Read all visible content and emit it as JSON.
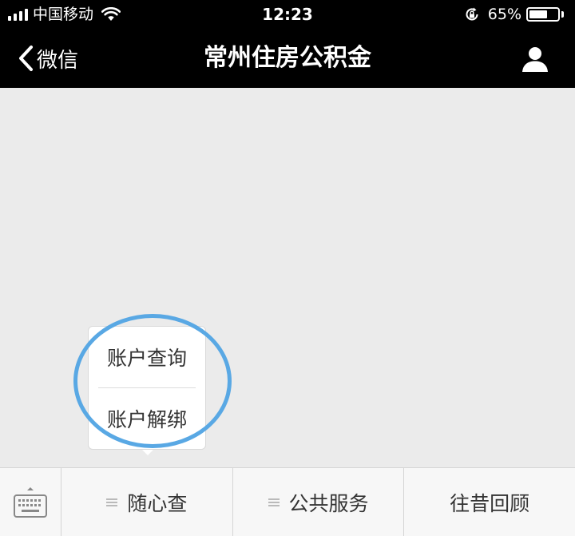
{
  "status_bar": {
    "carrier": "中国移动",
    "time": "12:23",
    "battery_percent": "65%",
    "battery_level": 0.65
  },
  "nav_bar": {
    "back_label": "微信",
    "title": "常州住房公积金"
  },
  "popup_menu": {
    "items": [
      {
        "label": "账户查询"
      },
      {
        "label": "账户解绑"
      }
    ]
  },
  "menu_bar": {
    "tabs": [
      {
        "label": "随心查",
        "has_submenu": true
      },
      {
        "label": "公共服务",
        "has_submenu": true
      },
      {
        "label": "往昔回顾",
        "has_submenu": false
      }
    ]
  },
  "colors": {
    "highlight_circle": "#59a8e4",
    "header_background": "#000000",
    "chat_background": "#ebebeb"
  }
}
